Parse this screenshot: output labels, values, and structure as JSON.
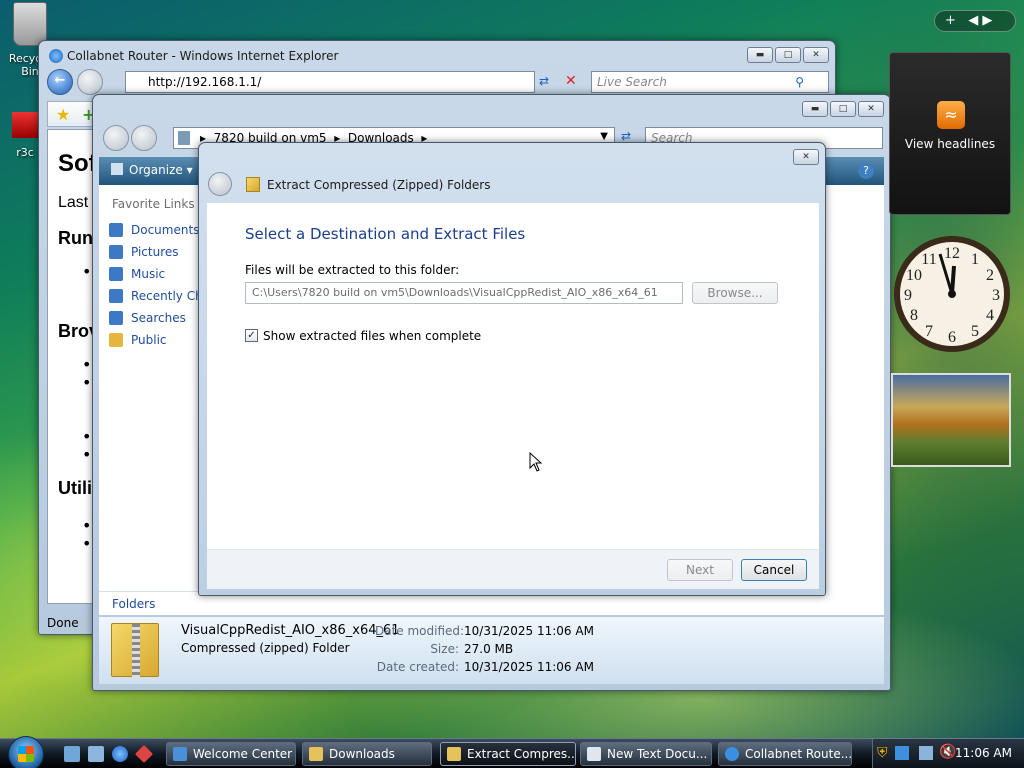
{
  "desktop": {
    "recycle_label": "Recycle Bin",
    "shortcut_label": "r3c"
  },
  "ie": {
    "title": "Collabnet Router - Windows Internet Explorer",
    "address": "http://192.168.1.1/",
    "search_placeholder": "Live Search",
    "status": "Done",
    "page": {
      "h1": "Sof",
      "p": "Last",
      "h2_1": "Run",
      "h2_2": "Brov",
      "h2_3": "Utili"
    }
  },
  "explorer": {
    "breadcrumb": [
      "7820 build on vm5",
      "Downloads"
    ],
    "search_placeholder": "Search",
    "organize": "Organize",
    "favorites_header": "Favorite Links",
    "favorites": [
      {
        "label": "Documents",
        "color": "#3d78c5"
      },
      {
        "label": "Pictures",
        "color": "#3d78c5"
      },
      {
        "label": "Music",
        "color": "#3d78c5"
      },
      {
        "label": "Recently Cha",
        "color": "#3d78c5"
      },
      {
        "label": "Searches",
        "color": "#3d78c5"
      },
      {
        "label": "Public",
        "color": "#e6b53c"
      }
    ],
    "folders_label": "Folders",
    "details": {
      "name": "VisualCppRedist_AIO_x86_x64_61",
      "type": "Compressed (zipped) Folder",
      "modified_label": "Date modified:",
      "modified": "10/31/2025 11:06 AM",
      "size_label": "Size:",
      "size": "27.0 MB",
      "created_label": "Date created:",
      "created": "10/31/2025 11:06 AM"
    }
  },
  "dialog": {
    "title": "Extract Compressed (Zipped) Folders",
    "heading": "Select a Destination and Extract Files",
    "label": "Files will be extracted to this folder:",
    "path": "C:\\Users\\7820 build on vm5\\Downloads\\VisualCppRedist_AIO_x86_x64_61",
    "browse": "Browse...",
    "checkbox_label": "Show extracted files when complete",
    "checkbox_checked": true,
    "next": "Next",
    "cancel": "Cancel"
  },
  "gadgets": {
    "rss_label": "View headlines"
  },
  "taskbar": {
    "buttons": [
      {
        "label": "Welcome Center",
        "active": false,
        "color": "#4a90d9"
      },
      {
        "label": "Downloads",
        "active": false,
        "color": "#e6c25a"
      },
      {
        "label": "Extract Compres...",
        "active": true,
        "color": "#e6c25a"
      },
      {
        "label": "New Text Docu...",
        "active": false,
        "color": "#dfe6ee"
      },
      {
        "label": "Collabnet Route...",
        "active": false,
        "color": "#3b8fe0"
      }
    ],
    "clock": "11:06 AM"
  }
}
